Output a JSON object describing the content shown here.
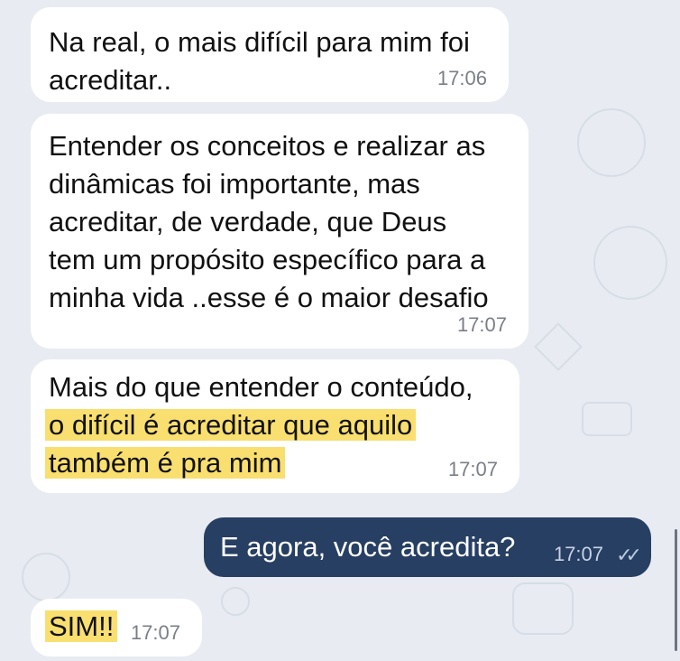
{
  "messages": [
    {
      "id": "m1",
      "direction": "incoming",
      "text": "Na real, o mais difícil para mim foi\nacreditar..",
      "time": "17:06"
    },
    {
      "id": "m2",
      "direction": "incoming",
      "text": "Entender os conceitos e realizar as\ndinâmicas foi importante, mas\nacreditar, de verdade, que Deus\ntem um propósito específico para a\nminha vida ..esse é o maior desafio",
      "time": "17:07"
    },
    {
      "id": "m3",
      "direction": "incoming",
      "line1": "Mais do que entender o conteúdo,",
      "highlight1": "o difícil é acreditar que aquilo",
      "highlight2": "também é pra mim",
      "time": "17:07"
    },
    {
      "id": "m4",
      "direction": "outgoing",
      "text": "E agora, você acredita?",
      "time": "17:07",
      "status": "read"
    },
    {
      "id": "m5",
      "direction": "incoming",
      "text": "SIM!!",
      "time": "17:07"
    }
  ],
  "colors": {
    "background": "#e8ecf2",
    "incoming_bubble": "#ffffff",
    "outgoing_bubble": "#273f63",
    "highlight": "#f9df6f"
  }
}
